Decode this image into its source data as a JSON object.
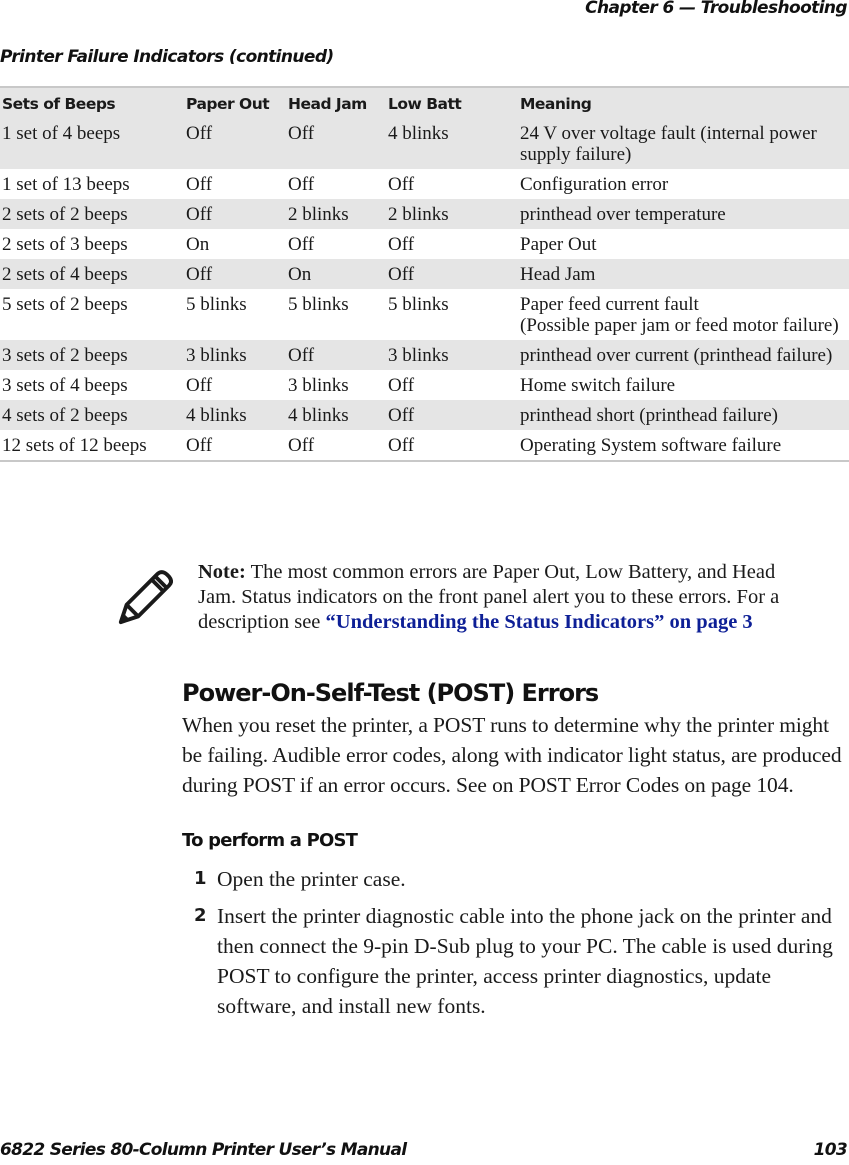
{
  "header": {
    "running_head": "Chapter 6 — Troubleshooting"
  },
  "table": {
    "title": "Printer Failure Indicators  (continued)",
    "columns": [
      "Sets of Beeps",
      "Paper Out",
      "Head Jam",
      "Low Batt",
      "Meaning"
    ],
    "rows": [
      [
        "1 set of 4 beeps",
        "Off",
        "Off",
        "4 blinks",
        "24 V over voltage fault (internal power supply failure)"
      ],
      [
        "1 set of 13 beeps",
        "Off",
        "Off",
        "Off",
        "Configuration error"
      ],
      [
        "2 sets of 2 beeps",
        "Off",
        "2 blinks",
        "2 blinks",
        "printhead over temperature"
      ],
      [
        "2 sets of 3 beeps",
        "On",
        "Off",
        "Off",
        "Paper Out"
      ],
      [
        "2 sets of 4 beeps",
        "Off",
        "On",
        "Off",
        "Head Jam"
      ],
      [
        "5 sets of 2 beeps",
        "5 blinks",
        "5 blinks",
        "5 blinks",
        "Paper feed current fault\n(Possible paper jam or feed motor failure)"
      ],
      [
        "3 sets of 2 beeps",
        "3 blinks",
        "Off",
        "3 blinks",
        "printhead over current (printhead failure)"
      ],
      [
        "3 sets of 4 beeps",
        "Off",
        "3 blinks",
        "Off",
        "Home switch failure"
      ],
      [
        "4 sets of 2 beeps",
        "4 blinks",
        "4 blinks",
        "Off",
        "printhead short (printhead failure)"
      ],
      [
        "12 sets of 12 beeps",
        "Off",
        "Off",
        "Off",
        "Operating System software failure"
      ]
    ],
    "shaded_rows": [
      0,
      2,
      4,
      6,
      8
    ]
  },
  "note": {
    "icon": "pencil-icon",
    "label": "Note:",
    "text": " The most common errors are Paper Out, Low Battery, and Head Jam. Status indicators on the front panel alert you to these errors. For a description see ",
    "link_text": "“Understanding the Status Indicators” on page 3",
    "link_color": "#0d1f96"
  },
  "post_section": {
    "heading": "Power-On-Self-Test (POST) Errors",
    "body": "When you reset the printer, a POST runs to determine why the printer might be failing. Audible error codes, along with indicator light status, are produced during POST if an error occurs. See on POST Error Codes on page 104.",
    "procedure_heading": "To perform a POST",
    "steps": [
      {
        "number": "1",
        "text": "Open the printer case."
      },
      {
        "number": "2",
        "text": "Insert the printer diagnostic cable into the phone jack on the printer and then connect the 9-pin D-Sub plug to your PC. The cable is used during POST to configure the printer, access printer diagnostics, update software, and install new fonts."
      }
    ]
  },
  "footer": {
    "manual_title": "6822 Series 80-Column Printer User’s Manual",
    "page_number": "103"
  }
}
